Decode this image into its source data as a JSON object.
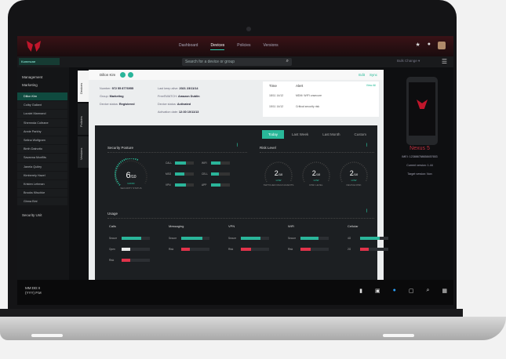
{
  "topnav": {
    "tabs": [
      "Dashboard",
      "Devices",
      "Policies",
      "Versions"
    ],
    "active": 1
  },
  "subbar": {
    "company": "Kommune",
    "search_placeholder": "Search for a device or group",
    "bulk": "Bulk Change"
  },
  "sidebar": {
    "groups": [
      "Management",
      "Marketing"
    ],
    "users": [
      "Dillon Kim",
      "Colby Gallant",
      "Loralei Marmand",
      "Shemnda Coltrane",
      "Annie Parkhy",
      "Selina Wolfgram",
      "Binth Dalnotto",
      "Savanna Mcnflits",
      "Janela Quiley",
      "Kimberely Hazel",
      "Kristen Lehman",
      "Brooks Kitschke",
      "Ginna Binl"
    ],
    "footer": "Security Unit"
  },
  "vtabs": [
    "Devices",
    "Policies",
    "Versions"
  ],
  "device": {
    "user": "Dillon Kim",
    "actions": [
      "Edit",
      "Sync"
    ],
    "number_label": "Number:",
    "number": "972 55 8776955",
    "group_label": "Group:",
    "group": "Marketing",
    "status_label": "Device status:",
    "status": "Registered",
    "keepalive_label": "Last keep alive:",
    "keepalive": "2021 23/11/14",
    "freewatch_label": "FreeSWATCH:",
    "freewatch": "Amazon Dublin",
    "devstatus_label": "Device status:",
    "devstatus": "Activated",
    "activation_label": "Activation date:",
    "activation": "12:30 10/11/13"
  },
  "alerts": {
    "time_h": "Time",
    "alert_h": "Alert",
    "view_all": "View All",
    "rows": [
      {
        "time": "18/11 14/12",
        "text": "MDM: WIFI unsecure"
      },
      {
        "time": "15/11 14/12",
        "text": "Critical security risk"
      }
    ]
  },
  "timeframe": {
    "options": [
      "Today",
      "Last Week",
      "Last Month",
      "Custom"
    ],
    "active": 0
  },
  "security": {
    "title": "Security Posture",
    "value": "6",
    "of": "/10",
    "level": "GOOD",
    "label": "SECURITY STATUS",
    "items": [
      {
        "n": "CALL",
        "v": 0.6
      },
      {
        "n": "WIFI",
        "v": 0.5
      },
      {
        "n": "MSG",
        "v": 0.5
      },
      {
        "n": "CELL",
        "v": 0.4
      },
      {
        "n": "VPN",
        "v": 0.6
      },
      {
        "n": "APP",
        "v": 0.5
      }
    ]
  },
  "risk": {
    "title": "Risk Level",
    "gauges": [
      {
        "v": "2",
        "of": "/10",
        "level": "LOW",
        "label": "SWITCHED MAILS EVENTS"
      },
      {
        "v": "2",
        "of": "/10",
        "level": "LOW",
        "label": "RISK LEVEL"
      },
      {
        "v": "2",
        "of": "/10",
        "level": "LOW",
        "label": "DEVICE RISK"
      }
    ]
  },
  "usage": {
    "title": "Usage",
    "cols": [
      {
        "name": "Calls",
        "rows": [
          {
            "n": "Secure",
            "v": 0.7,
            "c": "#2ab59a"
          },
          {
            "n": "Open",
            "v": 0.3,
            "c": "#e8e8e8"
          },
          {
            "n": "Risk",
            "v": 0.3,
            "c": "#e0334a"
          }
        ]
      },
      {
        "name": "Messaging",
        "rows": [
          {
            "n": "Secure",
            "v": 0.75,
            "c": "#2ab59a"
          },
          {
            "n": "Risk",
            "v": 0.3,
            "c": "#e0334a"
          }
        ]
      },
      {
        "name": "VPN",
        "rows": [
          {
            "n": "Secure",
            "v": 0.7,
            "c": "#2ab59a"
          },
          {
            "n": "Risk",
            "v": 0.35,
            "c": "#e0334a"
          }
        ]
      },
      {
        "name": "WiFi",
        "rows": [
          {
            "n": "Secure",
            "v": 0.65,
            "c": "#2ab59a"
          },
          {
            "n": "Risk",
            "v": 0.35,
            "c": "#e0334a"
          }
        ]
      },
      {
        "name": "Cellular",
        "rows": [
          {
            "n": "4G",
            "v": 0.7,
            "c": "#2ab59a"
          },
          {
            "n": "2G",
            "v": 0.3,
            "c": "#e0334a"
          }
        ]
      }
    ]
  },
  "phone": {
    "name": "Nexus 5",
    "imei": "IMEI: 123886768658457653",
    "current": "Current version: 1.44",
    "target": "Target version: Non"
  },
  "taskbar": {
    "time": "MM:DD:II",
    "date": "(YYY) P.M"
  }
}
